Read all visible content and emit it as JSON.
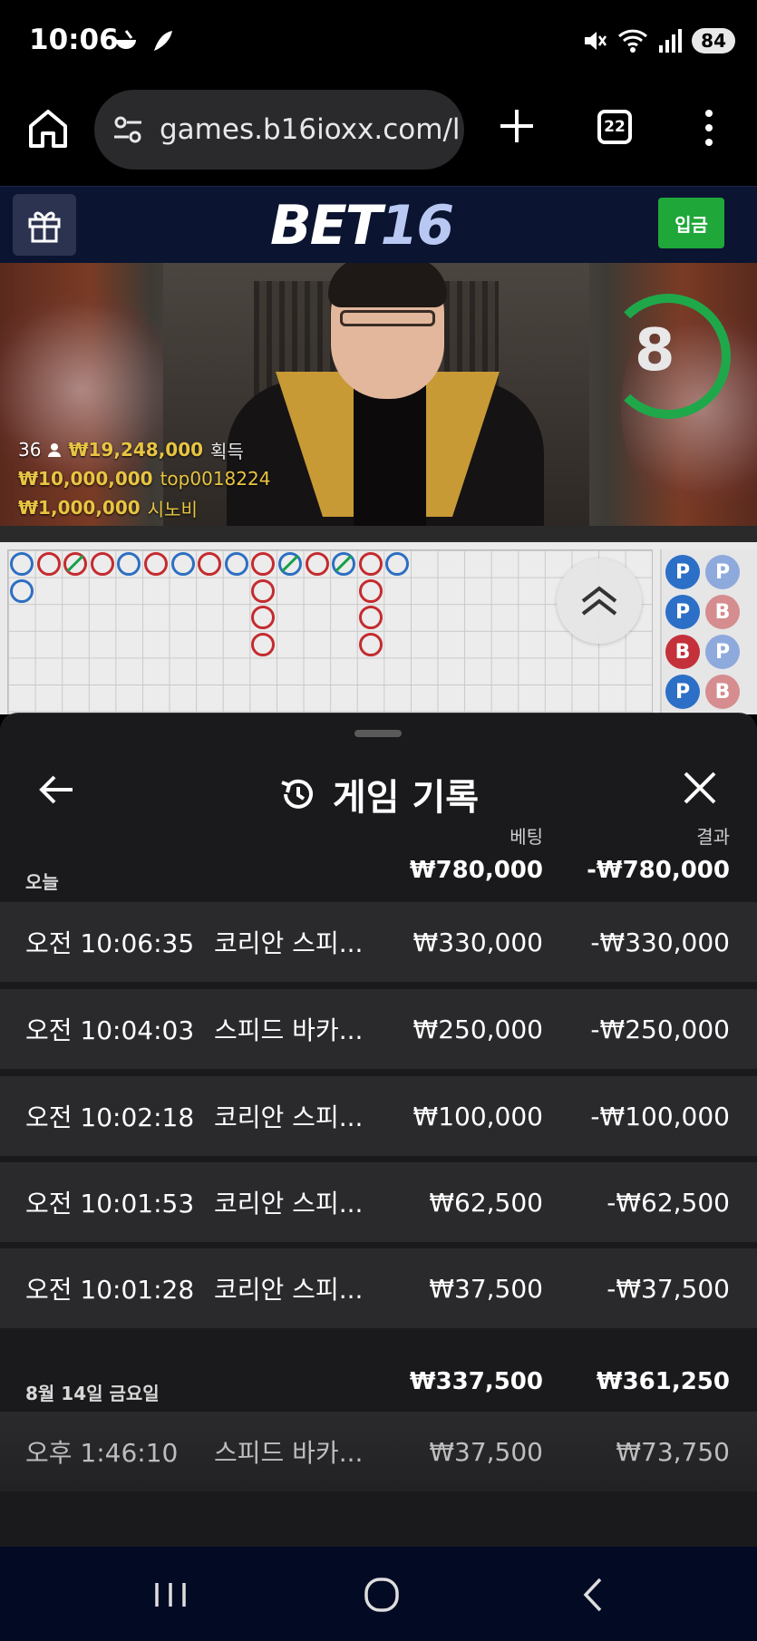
{
  "status_bar": {
    "time": "10:06",
    "battery": "84",
    "icons": [
      "weather-icon",
      "feather-icon",
      "mute-icon",
      "wifi-icon",
      "signal-icon"
    ]
  },
  "browser": {
    "url": "games.b16ioxx.com/l",
    "tab_count": "22"
  },
  "site": {
    "logo_bet": "BET",
    "logo_num": "16",
    "deposit_label": "입금",
    "colors": {
      "header_bg": "#0b1430",
      "deposit": "#1fa73a",
      "logo_accent": "#b9c8f2"
    }
  },
  "video": {
    "timer": "8",
    "winners_count": "36",
    "win_amount": "₩19,248,000",
    "win_suffix": "획득",
    "top_amount": "₩10,000,000",
    "top_user": "top0018224",
    "tip_amount": "₩1,000,000",
    "tip_label": "시노비"
  },
  "roadmap": {
    "bead_columns": [
      [
        "P",
        "P"
      ],
      [
        "B"
      ],
      [
        "B-tie"
      ],
      [
        "B"
      ],
      [
        "P"
      ],
      [
        "B"
      ],
      [
        "P"
      ],
      [
        "B"
      ],
      [
        "P"
      ],
      [
        "B",
        "B",
        "B",
        "B"
      ],
      [
        "P-tie"
      ],
      [
        "B"
      ],
      [
        "P-tie"
      ],
      [
        "B",
        "B",
        "B",
        "B"
      ],
      [
        "P"
      ]
    ],
    "big_road": [
      [
        "P",
        "P",
        "B",
        "P"
      ],
      [
        "P",
        "B",
        "P",
        "B"
      ]
    ]
  },
  "history": {
    "title": "게임 기록",
    "col_bet": "베팅",
    "col_result": "결과",
    "groups": [
      {
        "label": "오늘",
        "bet_total": "₩780,000",
        "result_total": "-₩780,000",
        "rows": [
          {
            "time": "오전 10:06:35",
            "game": "코리안 스피...",
            "bet": "₩330,000",
            "result": "-₩330,000"
          },
          {
            "time": "오전 10:04:03",
            "game": "스피드 바카...",
            "bet": "₩250,000",
            "result": "-₩250,000"
          },
          {
            "time": "오전 10:02:18",
            "game": "코리안 스피...",
            "bet": "₩100,000",
            "result": "-₩100,000"
          },
          {
            "time": "오전 10:01:53",
            "game": "코리안 스피...",
            "bet": "₩62,500",
            "result": "-₩62,500"
          },
          {
            "time": "오전 10:01:28",
            "game": "코리안 스피...",
            "bet": "₩37,500",
            "result": "-₩37,500"
          }
        ]
      },
      {
        "label": "8월 14일 금요일",
        "bet_total": "₩337,500",
        "result_total": "₩361,250",
        "rows": [
          {
            "time": "오후 1:46:10",
            "game": "스피드 바카...",
            "bet": "₩37,500",
            "result": "₩73,750"
          }
        ]
      }
    ]
  }
}
